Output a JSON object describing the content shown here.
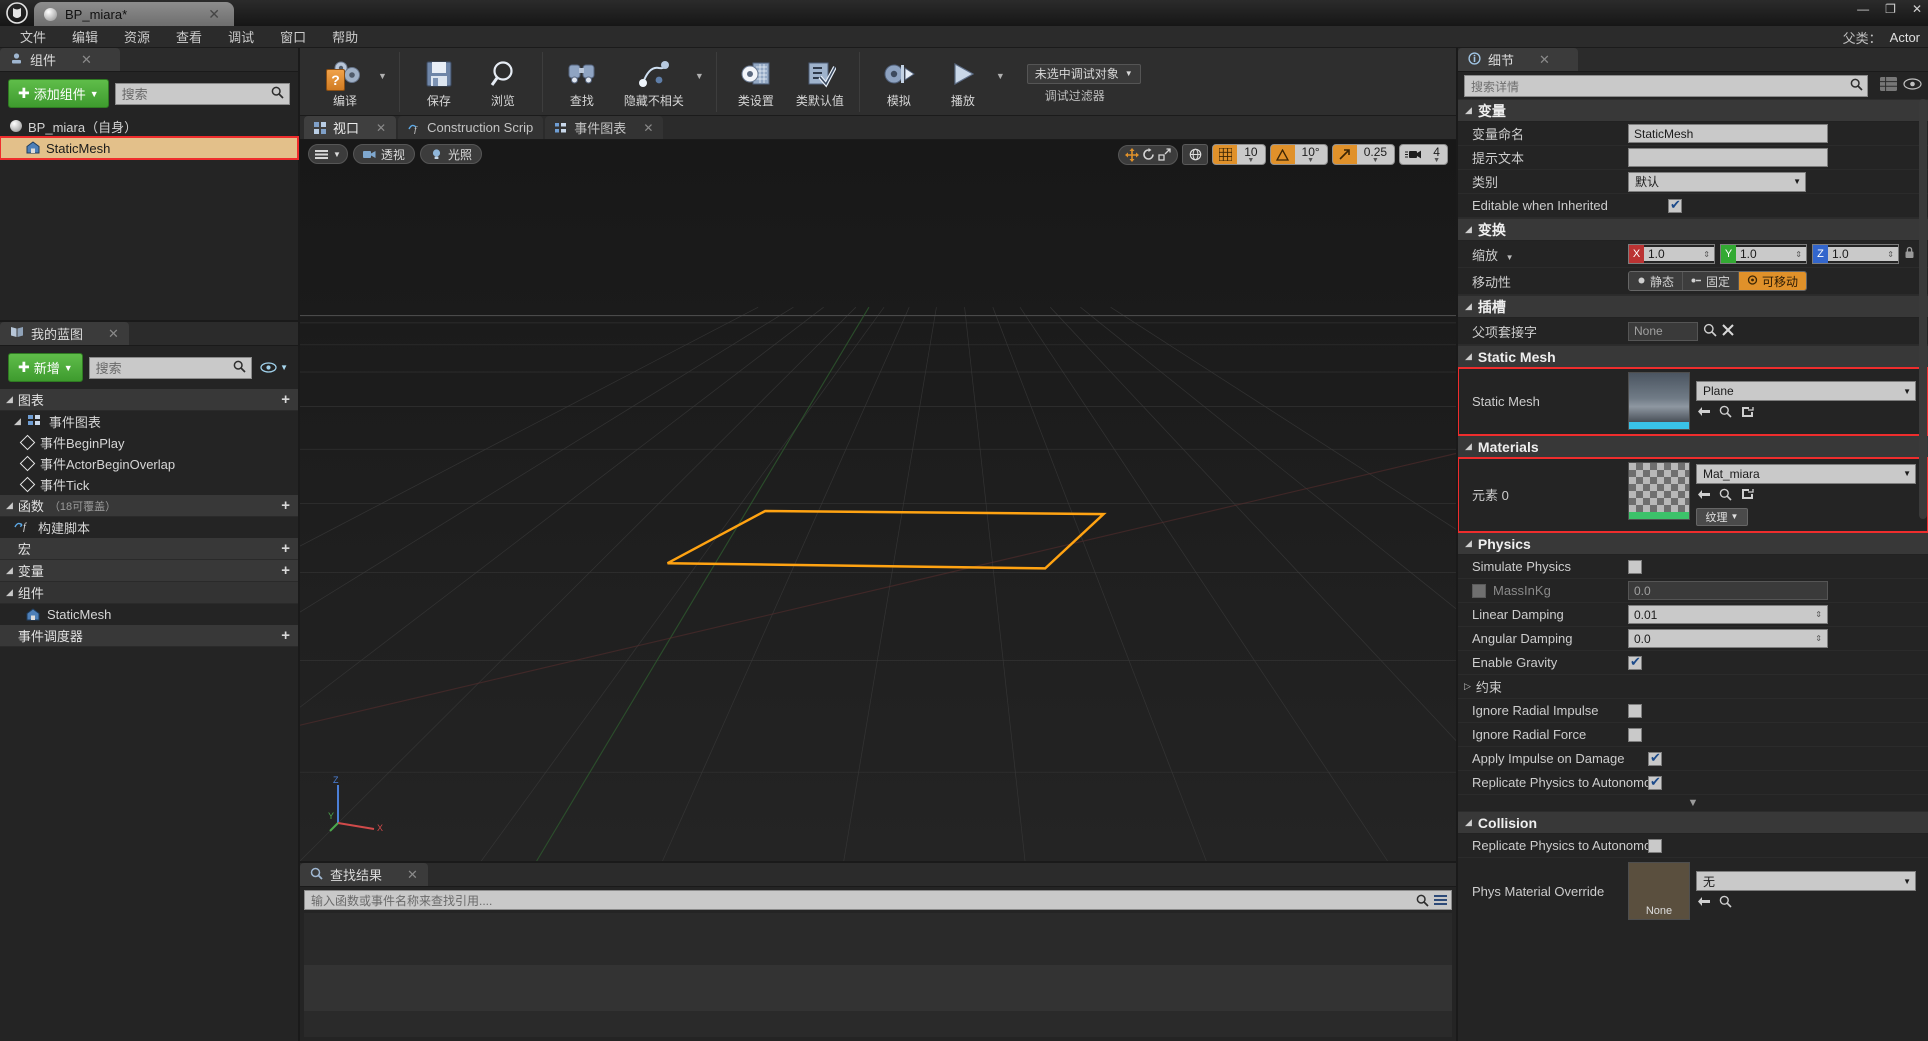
{
  "window": {
    "tab_title": "BP_miara*",
    "close_glyph": "✕",
    "minimize_glyph": "—",
    "maximize_glyph": "❐",
    "app_close_glyph": "✕",
    "logo_glyph": "𝖀"
  },
  "menu": {
    "items": [
      "文件",
      "编辑",
      "资源",
      "查看",
      "调试",
      "窗口",
      "帮助"
    ],
    "parent_label": "父类：",
    "parent_value": "Actor"
  },
  "toolbar": {
    "groups": [
      {
        "buttons": [
          {
            "label": "编译",
            "icon": "compile-icon",
            "has_caret": true
          }
        ]
      },
      {
        "buttons": [
          {
            "label": "保存",
            "icon": "save-icon"
          },
          {
            "label": "浏览",
            "icon": "browse-icon"
          }
        ]
      },
      {
        "buttons": [
          {
            "label": "查找",
            "icon": "find-icon"
          },
          {
            "label": "隐藏不相关",
            "icon": "hide-unrelated-icon",
            "has_caret": true
          }
        ]
      },
      {
        "buttons": [
          {
            "label": "类设置",
            "icon": "class-settings-icon"
          },
          {
            "label": "类默认值",
            "icon": "class-defaults-icon"
          }
        ]
      },
      {
        "buttons": [
          {
            "label": "模拟",
            "icon": "simulate-icon"
          },
          {
            "label": "播放",
            "icon": "play-icon",
            "has_caret": true
          }
        ]
      }
    ],
    "debug_object": "未选中调试对象",
    "debug_filter": "调试过滤器"
  },
  "components_panel": {
    "tab_label": "组件",
    "tab_close": "✕",
    "add_button": "添加组件",
    "add_plus": "✚",
    "add_caret": "▼",
    "search_placeholder": "搜索",
    "search_icon": "search-icon",
    "items": [
      {
        "label": "BP_miara（自身）",
        "icon": "actor-orb-icon",
        "selected": false,
        "indent": 0
      },
      {
        "label": "StaticMesh",
        "icon": "static-mesh-icon",
        "selected": true,
        "indent": 1
      }
    ]
  },
  "myblueprint_panel": {
    "tab_label": "我的蓝图",
    "tab_close": "✕",
    "add_button": "新增",
    "add_plus": "✚",
    "add_caret": "▼",
    "search_placeholder": "搜索",
    "search_icon": "search-icon",
    "eye_icon": "eye-icon",
    "sections": [
      {
        "title": "图表",
        "add_glyph": "+",
        "children": [
          {
            "label": "事件图表",
            "icon": "event-graph-icon",
            "level": 1
          },
          {
            "label": "事件BeginPlay",
            "icon": "event-node-icon",
            "level": 2
          },
          {
            "label": "事件ActorBeginOverlap",
            "icon": "event-node-icon",
            "level": 2
          },
          {
            "label": "事件Tick",
            "icon": "event-node-icon",
            "level": 2
          }
        ]
      },
      {
        "title": "函数",
        "suffix": "（18可覆盖）",
        "add_glyph": "+",
        "children": [
          {
            "label": "构建脚本",
            "icon": "function-icon",
            "level": 1
          }
        ]
      },
      {
        "title": "宏",
        "add_glyph": "+",
        "children": []
      },
      {
        "title": "变量",
        "add_glyph": "+",
        "children": []
      },
      {
        "title": "组件",
        "add_glyph": "",
        "children": [
          {
            "label": "StaticMesh",
            "icon": "static-mesh-icon",
            "level": 1
          }
        ]
      },
      {
        "title": "事件调度器",
        "add_glyph": "+",
        "children": []
      }
    ]
  },
  "view_tabs": [
    {
      "label": "视口",
      "icon": "viewport-icon",
      "active": true,
      "close": "✕"
    },
    {
      "label": "Construction Scrip",
      "icon": "construction-icon",
      "active": false
    },
    {
      "label": "事件图表",
      "icon": "event-graph-icon",
      "active": false,
      "close": "✕"
    }
  ],
  "viewport": {
    "menu_icon": "viewport-options-icon",
    "perspective": "透视",
    "lighting": "光照",
    "perspective_icon": "camera-icon",
    "lighting_icon": "lighting-icon",
    "transform_icons": [
      "move-icon",
      "rotate-icon",
      "scale-icon"
    ],
    "world_icon": "globe-icon",
    "snaps": [
      {
        "icon": "grid-snap-icon",
        "value": "10",
        "enabled": true
      },
      {
        "icon": "angle-snap-icon",
        "value": "10°",
        "enabled": true
      },
      {
        "icon": "scale-snap-icon",
        "value": "0.25",
        "enabled": true
      },
      {
        "icon": "camera-speed-icon",
        "value": "4",
        "enabled": false
      }
    ],
    "axis_labels": {
      "x": "X",
      "y": "Y",
      "z": "Z"
    }
  },
  "find_panel": {
    "tab_label": "查找结果",
    "tab_close": "✕",
    "tab_icon": "find-results-icon",
    "search_placeholder": "输入函数或事件名称来查找引用....",
    "search_icon": "search-icon",
    "filter_icon": "filter-icon"
  },
  "details_panel": {
    "tab_label": "细节",
    "tab_icon": "details-icon",
    "tab_close": "✕",
    "search_placeholder": "搜索详情",
    "search_icon": "search-icon",
    "grid_icon": "grid-view-icon",
    "eye_icon": "eye-icon",
    "scroll_glyph": "▼",
    "categories": [
      {
        "name": "变量",
        "type": "rows",
        "rows": [
          {
            "label": "变量命名",
            "control": "text",
            "value": "StaticMesh"
          },
          {
            "label": "提示文本",
            "control": "text",
            "value": ""
          },
          {
            "label": "类别",
            "control": "select",
            "value": "默认"
          },
          {
            "label": "Editable when Inherited",
            "control": "checkbox",
            "checked": true
          }
        ]
      },
      {
        "name": "变换",
        "type": "rows",
        "rows": [
          {
            "label": "缩放",
            "control": "xyz",
            "caret": "▾",
            "x": "1.0",
            "y": "1.0",
            "z": "1.0",
            "lock_icon": "lock-icon"
          },
          {
            "label": "移动性",
            "control": "mobility",
            "options": [
              {
                "label": "静态",
                "icon": "static-icon",
                "active": false
              },
              {
                "label": "固定",
                "icon": "stationary-icon",
                "active": false
              },
              {
                "label": "可移动",
                "icon": "movable-icon",
                "active": true
              }
            ]
          }
        ]
      },
      {
        "name": "插槽",
        "type": "rows",
        "rows": [
          {
            "label": "父项套接字",
            "control": "socket",
            "value": "None",
            "browse_icon": "browse-icon",
            "clear_icon": "clear-icon"
          }
        ]
      },
      {
        "name": "Static Mesh",
        "type": "asset",
        "highlighted": true,
        "asset": {
          "label": "Static Mesh",
          "value": "Plane",
          "thumb": "mesh-thumb",
          "mini_icons": [
            "back-arrow-icon",
            "browse-icon",
            "use-selected-icon"
          ]
        }
      },
      {
        "name": "Materials",
        "type": "asset",
        "highlighted": true,
        "asset": {
          "label": "元素 0",
          "value": "Mat_miara",
          "thumb": "checker-thumb",
          "mini_icons": [
            "back-arrow-icon",
            "browse-icon",
            "use-selected-icon"
          ],
          "extra_button": "纹理",
          "extra_caret": "▾"
        }
      },
      {
        "name": "Physics",
        "type": "rows",
        "rows": [
          {
            "label": "Simulate Physics",
            "control": "checkbox",
            "checked": false
          },
          {
            "label": "MassInKg",
            "control": "checkbox-text",
            "checked": false,
            "disabled": true,
            "value": "0.0"
          },
          {
            "label": "Linear Damping",
            "control": "text",
            "value": "0.01",
            "spinner": true
          },
          {
            "label": "Angular Damping",
            "control": "text",
            "value": "0.0",
            "spinner": true
          },
          {
            "label": "Enable Gravity",
            "control": "checkbox",
            "checked": true
          },
          {
            "label": "约束",
            "control": "expander",
            "glyph": "▷"
          },
          {
            "label": "Ignore Radial Impulse",
            "control": "checkbox",
            "checked": false
          },
          {
            "label": "Ignore Radial Force",
            "control": "checkbox",
            "checked": false
          },
          {
            "label": "Apply Impulse on Damage",
            "control": "checkbox",
            "checked": true
          },
          {
            "label": "Replicate Physics to Autonomo",
            "control": "checkbox",
            "checked": true
          }
        ]
      },
      {
        "name": "Collision",
        "type": "rows",
        "rows": [
          {
            "label": "Replicate Physics to Autonomo",
            "control": "checkbox",
            "checked": false
          },
          {
            "label": "Phys Material Override",
            "control": "asset-inline",
            "value": "无",
            "thumb_label": "None",
            "mini_icons": [
              "back-arrow-icon",
              "browse-icon"
            ]
          }
        ]
      }
    ]
  },
  "colors": {
    "accent_orange": "#e0912a",
    "highlight_red": "#ef2d2d",
    "selection_tan": "#e3c08a",
    "green_button": "#4aa832"
  }
}
